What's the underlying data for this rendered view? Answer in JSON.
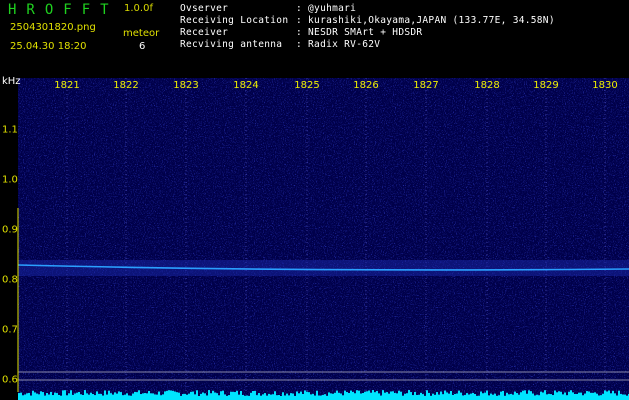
{
  "header": {
    "logo": "HROFFT",
    "version": "1.0.0f",
    "filename": "2504301820.png",
    "datetime": "25.04.30 18:20",
    "meteor_label": "meteor",
    "meteor_count": "6"
  },
  "info": [
    {
      "label": "Ovserver",
      "value": ": @yuhmari"
    },
    {
      "label": "Receiving Location",
      "value": ": kurashiki,Okayama,JAPAN (133.77E, 34.58N)"
    },
    {
      "label": "Receiver",
      "value": ": NESDR SMArt + HDSDR"
    },
    {
      "label": "Recviving antenna",
      "value": ": Radix RV-62V"
    }
  ],
  "axis": {
    "unit": "kHz",
    "x_ticks": [
      "1821",
      "1822",
      "1823",
      "1824",
      "1825",
      "1826",
      "1827",
      "1828",
      "1829",
      "1830"
    ],
    "y_ticks": [
      "1.1",
      "1.0",
      "0.9",
      "0.8",
      "0.7",
      "0.6"
    ]
  },
  "colors": {
    "background": "#00004a",
    "trace": "#2aa0ff",
    "logo": "#1fd11f",
    "label": "#e0e000",
    "bottom_noise": "#00e5ff"
  }
}
